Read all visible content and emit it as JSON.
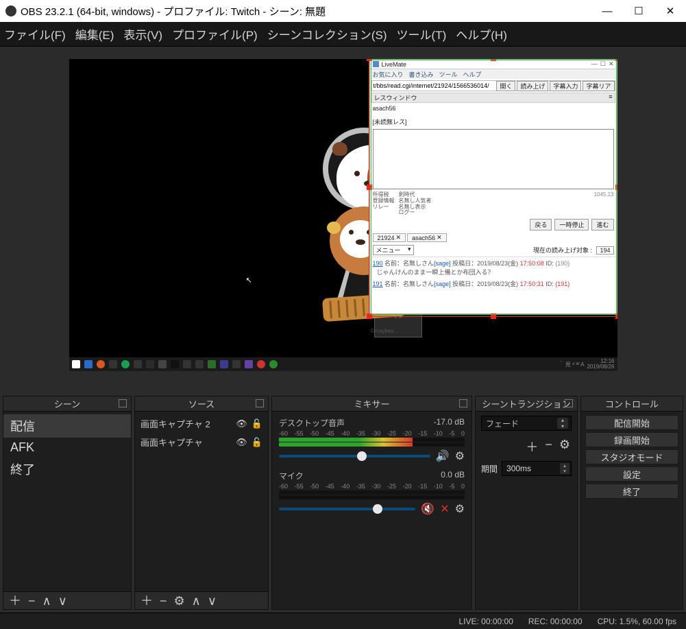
{
  "titlebar": {
    "text": "OBS 23.2.1 (64-bit, windows) - プロファイル: Twitch - シーン: 無題"
  },
  "menubar": {
    "file": "ファイル(F)",
    "edit": "編集(E)",
    "view": "表示(V)",
    "profile": "プロファイル(P)",
    "scene_collection": "シーンコレクション(S)",
    "tools": "ツール(T)",
    "help": "ヘルプ(H)"
  },
  "docks": {
    "scenes": {
      "title": "シーン",
      "items": [
        "配信",
        "AFK",
        "終了"
      ],
      "active_index": 0
    },
    "sources": {
      "title": "ソース",
      "items": [
        {
          "label": "画面キャプチャ 2",
          "visible": true,
          "locked": false
        },
        {
          "label": "画面キャプチャ",
          "visible": true,
          "locked": false
        }
      ]
    },
    "mixer": {
      "title": "ミキサー",
      "scale_labels": [
        "-60",
        "-55",
        "-50",
        "-45",
        "-40",
        "-35",
        "-30",
        "-25",
        "-20",
        "-15",
        "-10",
        "-5",
        "0"
      ],
      "channels": [
        {
          "name": "デスクトップ音声",
          "db": "-17.0 dB",
          "level_pct": 72,
          "slider_pct": 55,
          "muted": false
        },
        {
          "name": "マイク",
          "db": "0.0 dB",
          "level_pct": 0,
          "slider_pct": 72,
          "muted": true
        }
      ]
    },
    "transitions": {
      "title": "シーントランジション",
      "selected": "フェード",
      "duration_label": "期間",
      "duration_value": "300ms"
    },
    "controls": {
      "title": "コントロール",
      "buttons": [
        "配信開始",
        "録画開始",
        "スタジオモード",
        "設定",
        "終了"
      ]
    }
  },
  "statusbar": {
    "live": "LIVE: 00:00:00",
    "rec": "REC: 00:00:00",
    "cpu": "CPU: 1.5%, 60.00 fps"
  },
  "capture": {
    "app_title": "LiveMate",
    "menus": [
      "お気に入り",
      "書き込み",
      "ツール",
      "ヘルプ"
    ],
    "url": "t/bbs/read.cgi/internet/21924/1566536014/",
    "url_buttons": [
      "開く",
      "読み上げ",
      "字幕入力",
      "字幕リア"
    ],
    "reply_window_label": "レスウィンドウ",
    "reply_window_icon": "≡",
    "thread_name": "asach56",
    "unread_label": "[未読無レス]",
    "footer_buttons": [
      "戻る",
      "一時停止",
      "進む"
    ],
    "tabs": [
      "21924",
      "asach56"
    ],
    "menu_dropdown": "メニュー",
    "read_target_label": "現在の読み上げ対象 :",
    "read_target_value": "194",
    "log": [
      {
        "no": "190",
        "name": "名前：名無しさん",
        "sage": "[sage]",
        "date": "投稿日：2019/08/23(金)",
        "time": "17:50:08",
        "id_label": "ID:",
        "id_value": "(190)",
        "id_class": "idgray",
        "body": "じゃんけんのまま一瞬上備とか布団入る？"
      },
      {
        "no": "191",
        "name": "名前：名無しさん",
        "sage": "[sage]",
        "date": "投稿日：2019/08/23(金)",
        "time": "17:50:31",
        "id_label": "ID:",
        "id_value": "(191)",
        "id_class": "idred",
        "body": ""
      }
    ],
    "small_cols": [
      "所得税\n登録情報\nリレー",
      "剣時代\n名無し人気者\n名無し表示\nログー"
    ],
    "size_label": "1045.13"
  },
  "taskbar": {
    "time": "12:16",
    "date": "2019/08/26"
  }
}
